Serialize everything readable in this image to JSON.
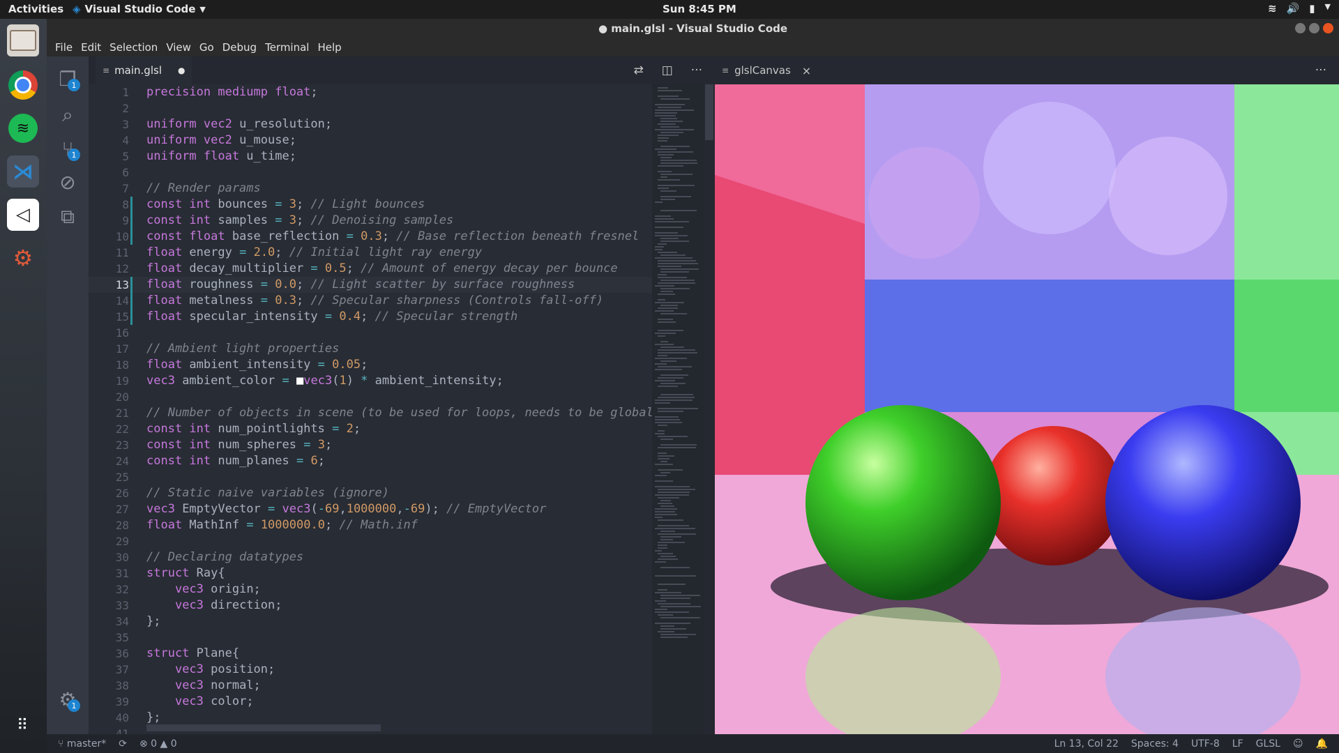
{
  "topbar": {
    "activities": "Activities",
    "app_name": "Visual Studio Code",
    "clock": "Sun  8:45 PM"
  },
  "window": {
    "title": "● main.glsl - Visual Studio Code"
  },
  "menu": [
    "File",
    "Edit",
    "Selection",
    "View",
    "Go",
    "Debug",
    "Terminal",
    "Help"
  ],
  "activity_bar": {
    "explorer_badge": "1",
    "scm_badge": "1",
    "settings_badge": "1"
  },
  "editor": {
    "tab_label": "main.glsl",
    "tab_dirty_dot": "●",
    "current_line": 13,
    "lines": [
      [
        [
          "kw",
          "precision mediump float"
        ],
        [
          "",
          "; "
        ]
      ],
      [],
      [
        [
          "kw",
          "uniform vec2"
        ],
        [
          "",
          " u_resolution;"
        ]
      ],
      [
        [
          "kw",
          "uniform vec2"
        ],
        [
          "",
          " u_mouse;"
        ]
      ],
      [
        [
          "kw",
          "uniform float"
        ],
        [
          "",
          " u_time;"
        ]
      ],
      [],
      [
        [
          "cm",
          "// Render params"
        ]
      ],
      [
        [
          "kw",
          "const int"
        ],
        [
          "",
          " bounces "
        ],
        [
          "op",
          "="
        ],
        [
          "",
          " "
        ],
        [
          "num",
          "3"
        ],
        [
          "",
          "; "
        ],
        [
          "cm",
          "// Light bounces"
        ]
      ],
      [
        [
          "kw",
          "const int"
        ],
        [
          "",
          " samples "
        ],
        [
          "op",
          "="
        ],
        [
          "",
          " "
        ],
        [
          "num",
          "3"
        ],
        [
          "",
          "; "
        ],
        [
          "cm",
          "// Denoising samples"
        ]
      ],
      [
        [
          "kw",
          "const float"
        ],
        [
          "",
          " base_reflection "
        ],
        [
          "op",
          "="
        ],
        [
          "",
          " "
        ],
        [
          "num",
          "0.3"
        ],
        [
          "",
          "; "
        ],
        [
          "cm",
          "// Base reflection beneath fresnel"
        ]
      ],
      [
        [
          "kw",
          "float"
        ],
        [
          "",
          " energy "
        ],
        [
          "op",
          "="
        ],
        [
          "",
          " "
        ],
        [
          "num",
          "2.0"
        ],
        [
          "",
          "; "
        ],
        [
          "cm",
          "// Initial light ray energy"
        ]
      ],
      [
        [
          "kw",
          "float"
        ],
        [
          "",
          " decay_multiplier "
        ],
        [
          "op",
          "="
        ],
        [
          "",
          " "
        ],
        [
          "num",
          "0.5"
        ],
        [
          "",
          "; "
        ],
        [
          "cm",
          "// Amount of energy decay per bounce"
        ]
      ],
      [
        [
          "kw",
          "float"
        ],
        [
          "",
          " roughness "
        ],
        [
          "op",
          "="
        ],
        [
          "",
          " "
        ],
        [
          "num",
          "0.0"
        ],
        [
          "",
          "; "
        ],
        [
          "cm",
          "// Light scatter by surface roughness"
        ]
      ],
      [
        [
          "kw",
          "float"
        ],
        [
          "",
          " metalness "
        ],
        [
          "op",
          "="
        ],
        [
          "",
          " "
        ],
        [
          "num",
          "0.3"
        ],
        [
          "",
          "; "
        ],
        [
          "cm",
          "// Specular sharpness (Controls fall-off)"
        ]
      ],
      [
        [
          "kw",
          "float"
        ],
        [
          "",
          " specular_intensity "
        ],
        [
          "op",
          "="
        ],
        [
          "",
          " "
        ],
        [
          "num",
          "0.4"
        ],
        [
          "",
          "; "
        ],
        [
          "cm",
          "// Specular strength"
        ]
      ],
      [],
      [
        [
          "cm",
          "// Ambient light properties"
        ]
      ],
      [
        [
          "kw",
          "float"
        ],
        [
          "",
          " ambient_intensity "
        ],
        [
          "op",
          "="
        ],
        [
          "",
          " "
        ],
        [
          "num",
          "0.05"
        ],
        [
          "",
          ";"
        ]
      ],
      [
        [
          "kw",
          "vec3"
        ],
        [
          "",
          " ambient_color "
        ],
        [
          "op",
          "="
        ],
        [
          "",
          " "
        ],
        [
          "sw",
          "■"
        ],
        [
          "kw",
          "vec3"
        ],
        [
          "",
          "("
        ],
        [
          "num",
          "1"
        ],
        [
          "",
          ") "
        ],
        [
          "op",
          "*"
        ],
        [
          "",
          " ambient_intensity;"
        ]
      ],
      [],
      [
        [
          "cm",
          "// Number of objects in scene (to be used for loops, needs to be global)"
        ]
      ],
      [
        [
          "kw",
          "const int"
        ],
        [
          "",
          " num_pointlights "
        ],
        [
          "op",
          "="
        ],
        [
          "",
          " "
        ],
        [
          "num",
          "2"
        ],
        [
          "",
          ";"
        ]
      ],
      [
        [
          "kw",
          "const int"
        ],
        [
          "",
          " num_spheres "
        ],
        [
          "op",
          "="
        ],
        [
          "",
          " "
        ],
        [
          "num",
          "3"
        ],
        [
          "",
          ";"
        ]
      ],
      [
        [
          "kw",
          "const int"
        ],
        [
          "",
          " num_planes "
        ],
        [
          "op",
          "="
        ],
        [
          "",
          " "
        ],
        [
          "num",
          "6"
        ],
        [
          "",
          ";"
        ]
      ],
      [],
      [
        [
          "cm",
          "// Static naive variables (ignore)"
        ]
      ],
      [
        [
          "kw",
          "vec3"
        ],
        [
          "",
          " EmptyVector "
        ],
        [
          "op",
          "="
        ],
        [
          "",
          " "
        ],
        [
          "kw",
          "vec3"
        ],
        [
          "",
          "("
        ],
        [
          "op",
          "-"
        ],
        [
          "num",
          "69"
        ],
        [
          "",
          ","
        ],
        [
          "num",
          "1000000"
        ],
        [
          "",
          ","
        ],
        [
          "op",
          "-"
        ],
        [
          "num",
          "69"
        ],
        [
          "",
          "); "
        ],
        [
          "cm",
          "// EmptyVector"
        ]
      ],
      [
        [
          "kw",
          "float"
        ],
        [
          "",
          " MathInf "
        ],
        [
          "op",
          "="
        ],
        [
          "",
          " "
        ],
        [
          "num",
          "1000000.0"
        ],
        [
          "",
          "; "
        ],
        [
          "cm",
          "// Math.inf"
        ]
      ],
      [],
      [
        [
          "cm",
          "// Declaring datatypes"
        ]
      ],
      [
        [
          "kw",
          "struct"
        ],
        [
          "",
          " Ray{"
        ]
      ],
      [
        [
          "",
          "    "
        ],
        [
          "kw",
          "vec3"
        ],
        [
          "",
          " origin;"
        ]
      ],
      [
        [
          "",
          "    "
        ],
        [
          "kw",
          "vec3"
        ],
        [
          "",
          " direction;"
        ]
      ],
      [
        [
          "",
          "};"
        ]
      ],
      [],
      [
        [
          "kw",
          "struct"
        ],
        [
          "",
          " Plane{"
        ]
      ],
      [
        [
          "",
          "    "
        ],
        [
          "kw",
          "vec3"
        ],
        [
          "",
          " position;"
        ]
      ],
      [
        [
          "",
          "    "
        ],
        [
          "kw",
          "vec3"
        ],
        [
          "",
          " normal;"
        ]
      ],
      [
        [
          "",
          "    "
        ],
        [
          "kw",
          "vec3"
        ],
        [
          "",
          " color;"
        ]
      ],
      [
        [
          "",
          "};"
        ]
      ],
      []
    ]
  },
  "preview": {
    "tab_label": "glslCanvas",
    "close": "×"
  },
  "statusbar": {
    "branch": "master*",
    "errors": "0",
    "warnings": "0",
    "position": "Ln 13, Col 22",
    "spaces": "Spaces: 4",
    "encoding": "UTF-8",
    "eol": "LF",
    "language": "GLSL"
  }
}
